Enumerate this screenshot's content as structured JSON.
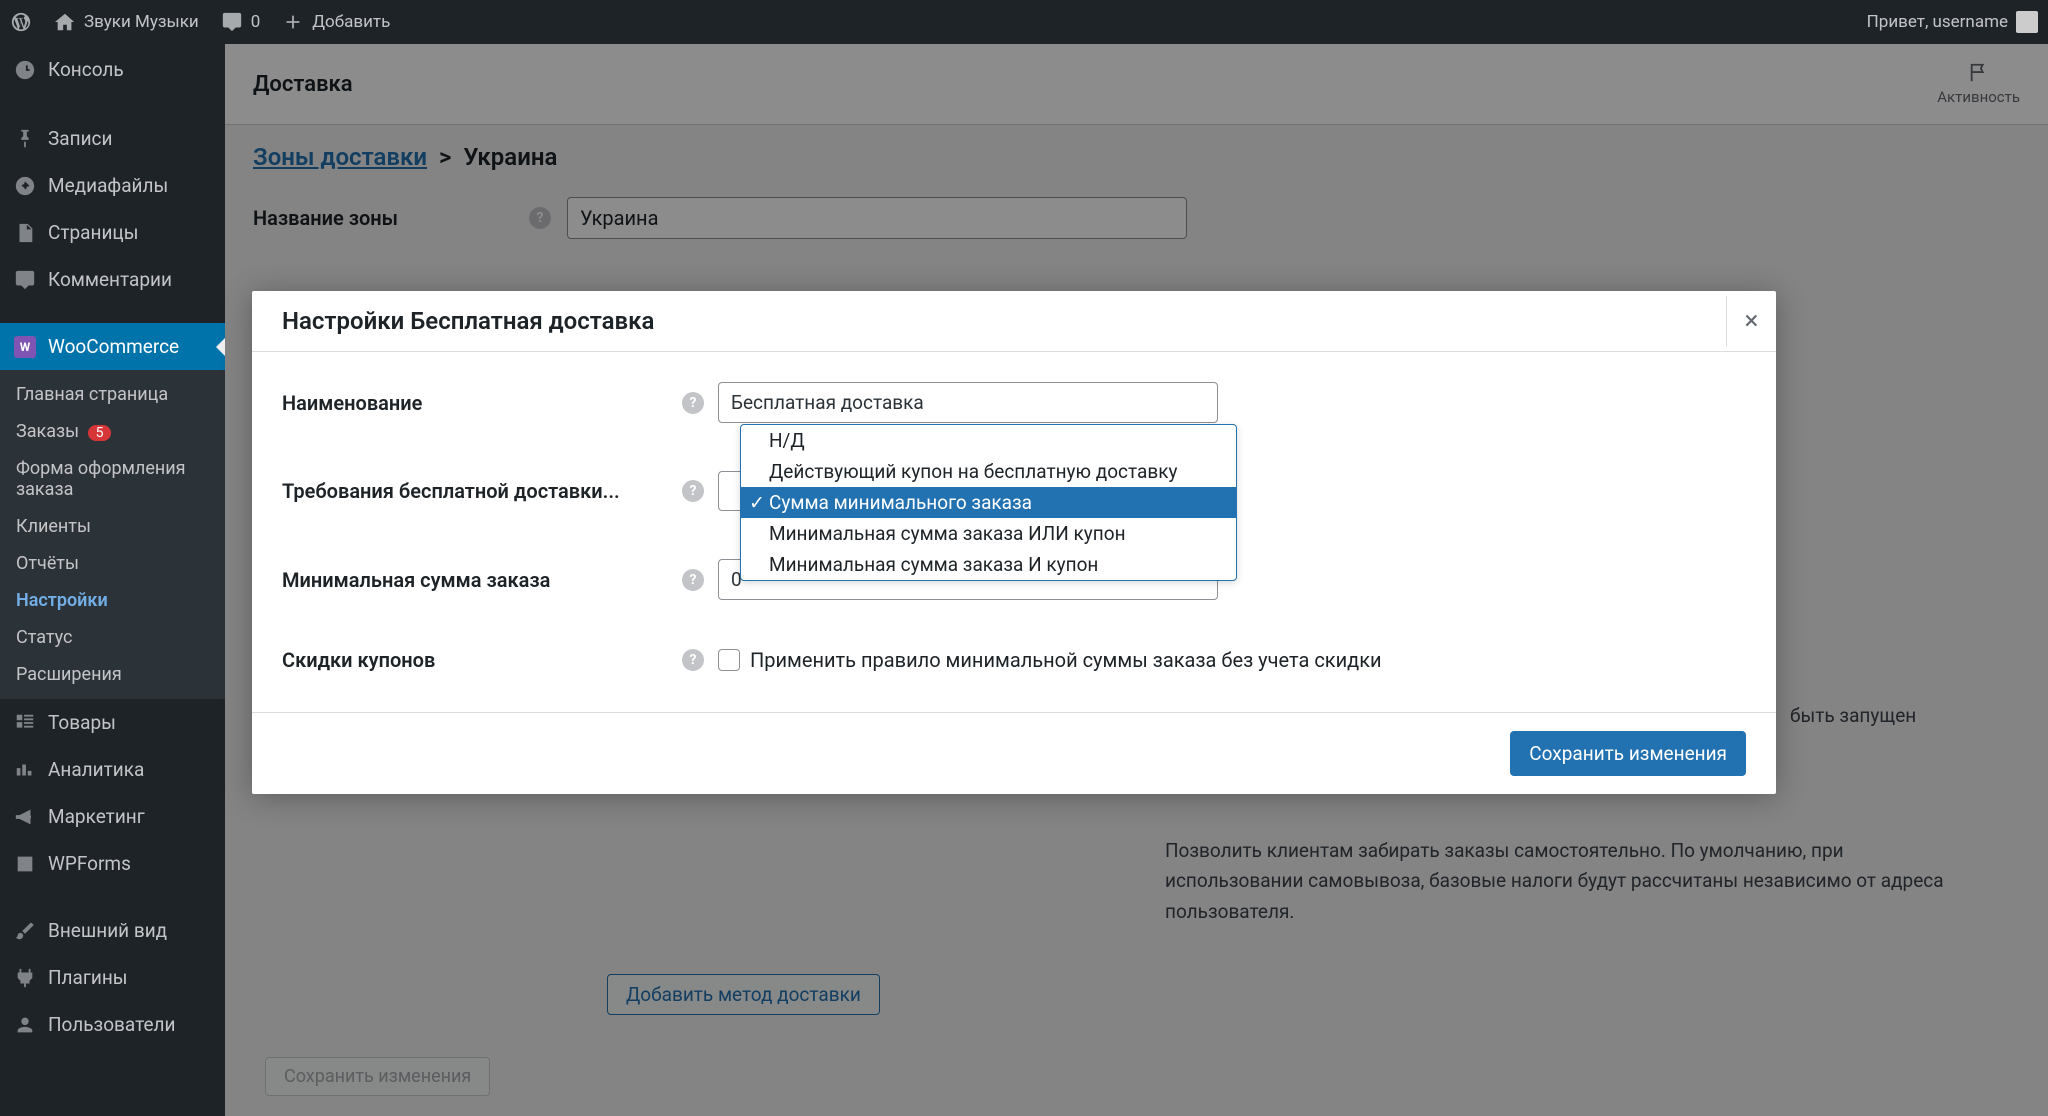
{
  "adminbar": {
    "site_name": "Звуки Музыки",
    "comments_count": "0",
    "add_new": "Добавить",
    "greeting": "Привет, username"
  },
  "sidebar": {
    "items": [
      {
        "label": "Консоль"
      },
      {
        "label": "Записи"
      },
      {
        "label": "Медиафайлы"
      },
      {
        "label": "Страницы"
      },
      {
        "label": "Комментарии"
      },
      {
        "label": "WooCommerce"
      },
      {
        "label": "Товары"
      },
      {
        "label": "Аналитика"
      },
      {
        "label": "Маркетинг"
      },
      {
        "label": "WPForms"
      },
      {
        "label": "Внешний вид"
      },
      {
        "label": "Плагины"
      },
      {
        "label": "Пользователи"
      }
    ],
    "submenu": [
      {
        "label": "Главная страница"
      },
      {
        "label": "Заказы",
        "badge": "5"
      },
      {
        "label": "Форма оформления заказа"
      },
      {
        "label": "Клиенты"
      },
      {
        "label": "Отчёты"
      },
      {
        "label": "Настройки"
      },
      {
        "label": "Статус"
      },
      {
        "label": "Расширения"
      }
    ]
  },
  "page": {
    "title": "Доставка",
    "activity": "Активность",
    "breadcrumb_link": "Зоны доставки",
    "breadcrumb_sep": ">",
    "breadcrumb_current": "Украина",
    "zone_name_label": "Название зоны",
    "zone_name_value": "Украина",
    "bg_text1": "быть запущен",
    "bg_text2": "Позволить клиентам забирать заказы самостоятельно. По умолчанию, при использовании самовывоза, базовые налоги будут рассчитаны независимо от адреса пользователя.",
    "add_method_btn": "Добавить метод доставки",
    "save_changes_bg": "Сохранить изменения"
  },
  "modal": {
    "title": "Настройки Бесплатная доставка",
    "name_label": "Наименование",
    "name_value": "Бесплатная доставка",
    "requires_label": "Требования бесплатной доставки...",
    "min_amount_label": "Минимальная сумма заказа",
    "min_amount_value": "0",
    "coupons_label": "Скидки купонов",
    "coupons_checkbox_label": "Применить правило минимальной суммы заказа без учета скидки",
    "save_btn": "Сохранить изменения"
  },
  "dropdown": {
    "options": [
      "Н/Д",
      "Действующий купон на бесплатную доставку",
      "Сумма минимального заказа",
      "Минимальная сумма заказа ИЛИ купон",
      "Минимальная сумма заказа И купон"
    ]
  }
}
